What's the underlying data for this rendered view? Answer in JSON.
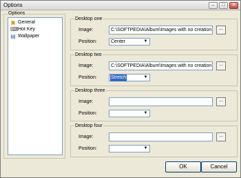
{
  "window": {
    "title": "Options"
  },
  "titlebar": {
    "minimize": "–",
    "maximize": "□",
    "close": "✕"
  },
  "options_group": {
    "label": "Options"
  },
  "tree": {
    "items": [
      {
        "label": "General",
        "icon": "folder-icon",
        "glyph": "▣"
      },
      {
        "label": "Hot Key",
        "icon": "keyboard-icon",
        "glyph": "⌨"
      },
      {
        "label": "Wallpaper",
        "icon": "picture-icon",
        "glyph": "▤"
      }
    ]
  },
  "labels": {
    "image": "Image:",
    "position": "Position:"
  },
  "desktops": [
    {
      "title": "Desktop one",
      "image": "C:\\SOFTPEDIA\\Album\\Images with no creation",
      "position": "Center"
    },
    {
      "title": "Desktop two",
      "image": "C:\\SOFTPEDIA\\Album\\Images with no creation",
      "position": "Stretch"
    },
    {
      "title": "Desktop three",
      "image": "",
      "position": ""
    },
    {
      "title": "Desktop four",
      "image": "",
      "position": ""
    }
  ],
  "browse_label": "...",
  "dropdown_arrow": "▼",
  "buttons": {
    "ok": "OK",
    "cancel": "Cancel"
  }
}
